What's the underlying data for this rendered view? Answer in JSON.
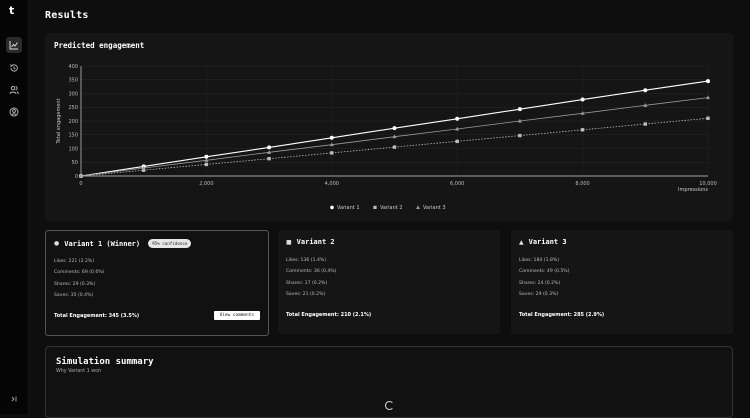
{
  "page": {
    "title": "Results"
  },
  "sidebar": {
    "logo": "t",
    "items": [
      {
        "name": "chart-icon",
        "active": true
      },
      {
        "name": "history-icon",
        "active": false
      },
      {
        "name": "users-icon",
        "active": false
      },
      {
        "name": "account-icon",
        "active": false
      }
    ],
    "collapse_icon": "expand-sidebar-icon"
  },
  "chart_card": {
    "title": "Predicted engagement"
  },
  "chart_data": {
    "type": "line",
    "title": "Predicted engagement",
    "xlabel": "Impressions",
    "ylabel": "Total engagement",
    "xlim": [
      0,
      10000
    ],
    "ylim": [
      0,
      400
    ],
    "x_ticks": [
      "0",
      "2,000",
      "4,000",
      "6,000",
      "8,000",
      "10,000"
    ],
    "y_ticks": [
      "0",
      "50",
      "100",
      "150",
      "200",
      "250",
      "300",
      "350",
      "400"
    ],
    "grid": true,
    "legend_placement": "bottom-center",
    "x": [
      0,
      1000,
      2000,
      3000,
      4000,
      5000,
      6000,
      7000,
      8000,
      9000,
      10000
    ],
    "series": [
      {
        "name": "Variant 1",
        "marker": "circle",
        "style": "solid",
        "color": "#ffffff",
        "values": [
          0,
          35,
          70,
          104,
          139,
          174,
          208,
          243,
          278,
          312,
          345
        ]
      },
      {
        "name": "Variant 2",
        "marker": "square",
        "style": "dotted",
        "color": "#bdbdbd",
        "values": [
          0,
          21,
          42,
          63,
          84,
          105,
          126,
          147,
          168,
          189,
          210
        ]
      },
      {
        "name": "Variant 3",
        "marker": "triangle",
        "style": "solid",
        "color": "#9a9a9a",
        "values": [
          0,
          29,
          57,
          86,
          114,
          143,
          171,
          200,
          228,
          257,
          285
        ]
      }
    ]
  },
  "variants": [
    {
      "title": "Variant 1 (Winner)",
      "badge": "95% confidence",
      "stats": [
        "Likes: 221 (2.2%)",
        "Comments: 69 (0.6%)",
        "Shares: 29 (0.3%)",
        "Saves: 35 (0.4%)"
      ],
      "total": "Total Engagement: 345 (3.5%)",
      "button": "View comments"
    },
    {
      "title": "Variant 2",
      "stats": [
        "Likes: 136 (1.4%)",
        "Comments: 36 (0.4%)",
        "Shares: 17 (0.2%)",
        "Saves: 21 (0.2%)"
      ],
      "total": "Total Engagement: 210 (2.1%)"
    },
    {
      "title": "Variant 3",
      "stats": [
        "Likes: 184 (1.8%)",
        "Comments: 49 (0.5%)",
        "Shares: 24 (0.2%)",
        "Saves: 29 (0.3%)"
      ],
      "total": "Total Engagement: 285 (2.9%)"
    }
  ],
  "summary": {
    "title": "Simulation summary",
    "subtitle": "Why Variant 1 won",
    "loading": true
  }
}
